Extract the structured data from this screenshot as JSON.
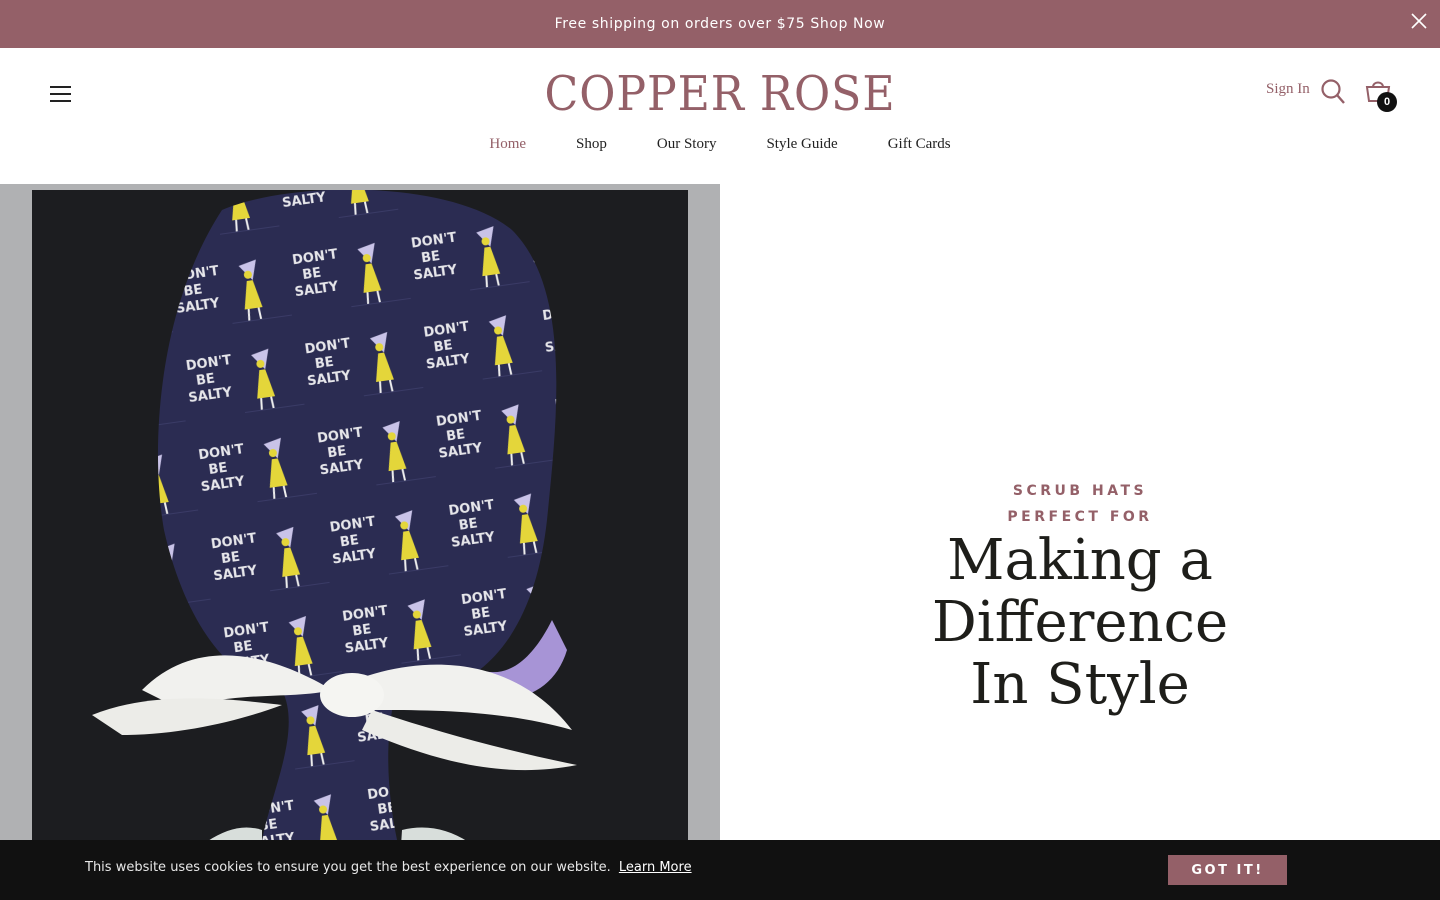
{
  "announcement": {
    "text": "Free shipping on orders over $75 Shop Now",
    "close_icon": "close-icon"
  },
  "header": {
    "logo": "COPPER ROSE",
    "sign_in": "Sign In",
    "cart_count": "0",
    "icons": {
      "menu": "hamburger-menu-icon",
      "search": "search-icon",
      "cart": "shopping-cart-icon"
    }
  },
  "nav": {
    "items": [
      {
        "label": "Home",
        "active": true
      },
      {
        "label": "Shop",
        "active": false
      },
      {
        "label": "Our Story",
        "active": false
      },
      {
        "label": "Style Guide",
        "active": false
      },
      {
        "label": "Gift Cards",
        "active": false
      }
    ]
  },
  "hero": {
    "eyebrow_line1": "SCRUB HATS",
    "eyebrow_line2": "PERFECT FOR",
    "headline_line1": "Making a",
    "headline_line2": "Difference",
    "headline_line3": "In Style",
    "image_text": "DON'T BE SALTY"
  },
  "cookie_banner": {
    "text": "This website uses cookies to ensure you get the best experience on our website.",
    "link": "Learn More",
    "button": "GOT IT!"
  },
  "colors": {
    "brand": "#946068",
    "announcement_bg": "#946068",
    "headline": "#1e1e1a",
    "cookie_bg": "#111111"
  }
}
